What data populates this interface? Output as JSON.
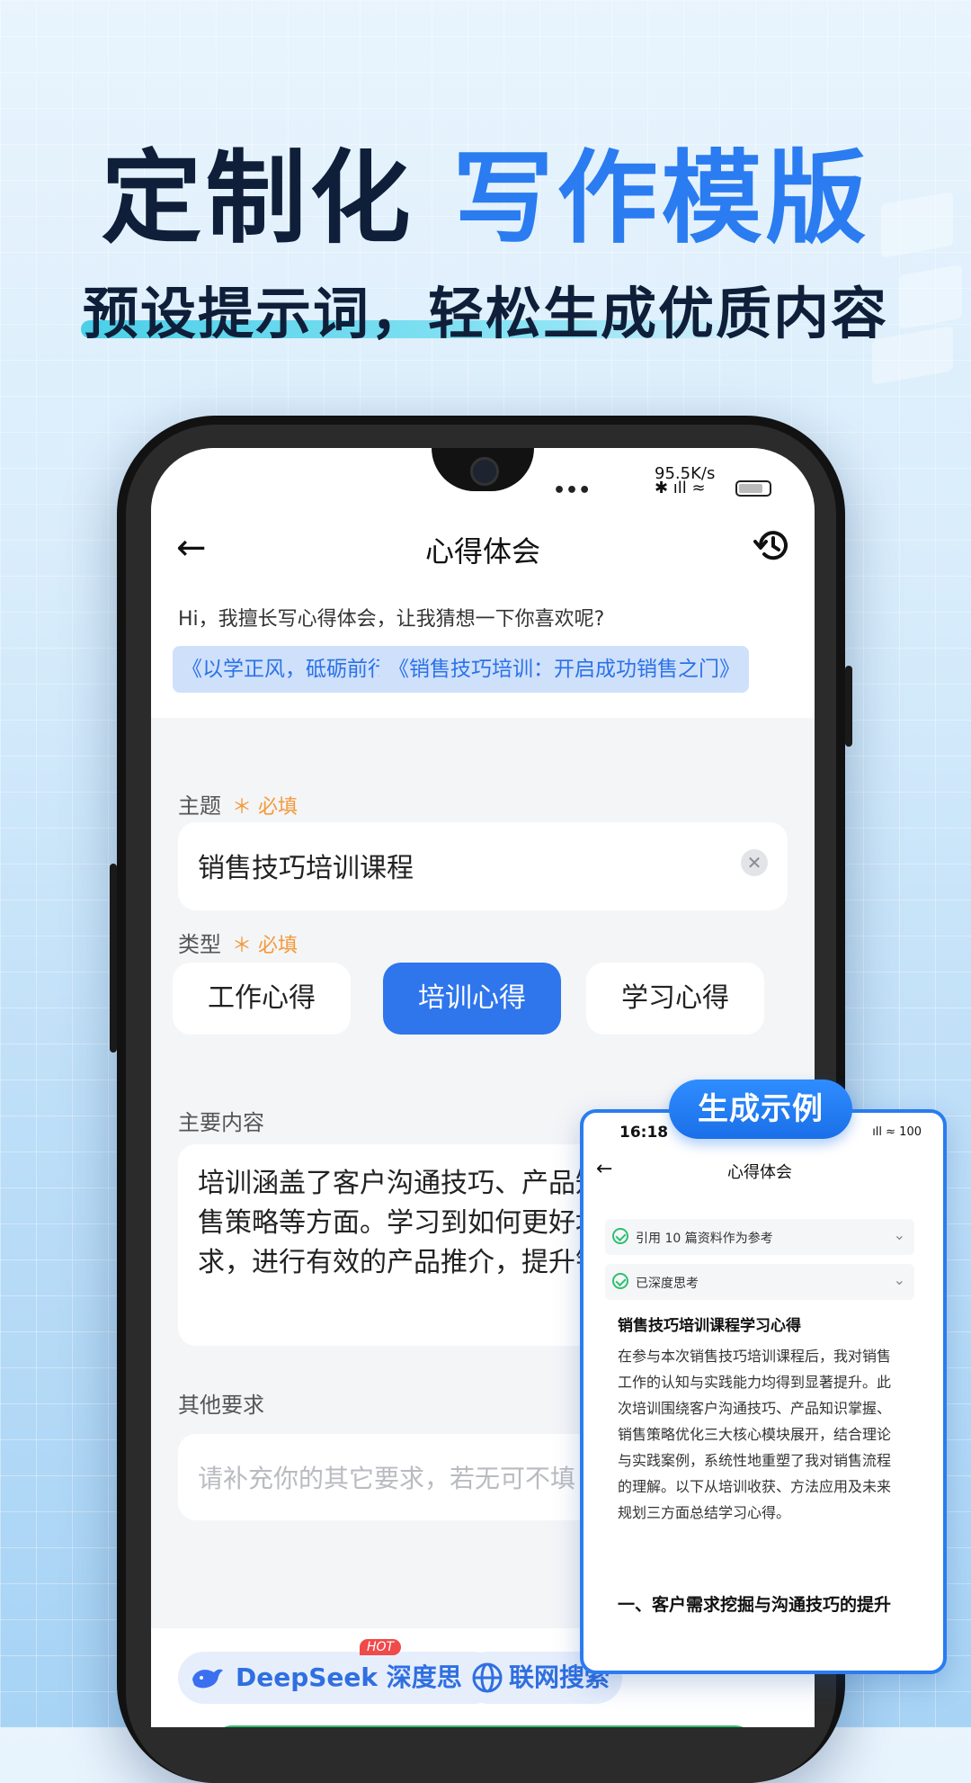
{
  "promo": {
    "headline_dark": "定制化 ",
    "headline_blue": "写作模版",
    "subline": "预设提示词，轻松生成优质内容",
    "colors": {
      "dark": "#0f1f3a",
      "blue": "#2a7cf0"
    }
  },
  "status_bar": {
    "dots": "•••",
    "speed": "95.5K/s",
    "icons": "✱ ıll ≈"
  },
  "nav": {
    "title": "心得体会",
    "back_icon": "arrow-left-icon",
    "history_icon": "history-icon"
  },
  "greeting": "Hi，我擅长写心得体会，让我猜想一下你喜欢呢?",
  "suggestions": [
    "《以学正风，砥砺前行》",
    "《销售技巧培训：开启成功销售之门》"
  ],
  "form": {
    "topic": {
      "label": "主题",
      "required": "＊ 必填",
      "value": "销售技巧培训课程",
      "clear_icon": "clear-icon"
    },
    "type": {
      "label": "类型",
      "required": "＊ 必填",
      "options": [
        "工作心得",
        "培训心得",
        "学习心得"
      ],
      "selected": "培训心得"
    },
    "content": {
      "label": "主要内容",
      "value": "培训涵盖了客户沟通技巧、产品知识掌握以及销售策略等方面。学习到如何更好地挖掘客户需求，进行有效的产品推介，提升销售业绩。"
    },
    "other": {
      "label": "其他要求",
      "placeholder": "请补充你的其它要求，若无可不填"
    }
  },
  "bottom_bar": {
    "deepseek_label": "DeepSeek 深度思考",
    "hot_badge": "HOT",
    "web_search_label": "联网搜索"
  },
  "example": {
    "badge": "生成示例",
    "time": "16:18",
    "status": "ıll ≈ 100",
    "title": "心得体会",
    "rows": [
      "引用 10 篇资料作为参考",
      "已深度思考"
    ],
    "heading": "销售技巧培训课程学习心得",
    "body": "在参与本次销售技巧培训课程后，我对销售工作的认知与实践能力均得到显著提升。此次培训围绕客户沟通技巧、产品知识掌握、销售策略优化三大核心模块展开，结合理论与实践案例，系统性地重塑了我对销售流程的理解。以下从培训收获、方法应用及未来规划三方面总结学习心得。",
    "section_title": "一、客户需求挖掘与沟通技巧的提升"
  }
}
